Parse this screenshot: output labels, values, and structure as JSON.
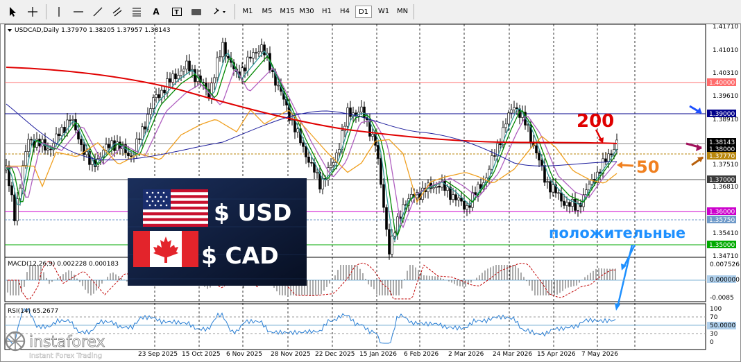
{
  "toolbar": {
    "timeframes": [
      "M1",
      "M5",
      "M15",
      "M30",
      "H1",
      "H4",
      "D1",
      "W1",
      "MN"
    ],
    "active_timeframe": "D1"
  },
  "chart": {
    "header": "USDCAD,Daily  1.37970 1.38205 1.37957 1.38143",
    "price_labels": [
      "1.41710",
      "1.41010",
      "1.40310",
      "1.39610",
      "1.38910",
      "1.37510",
      "1.36810",
      "1.35410",
      "1.34710"
    ],
    "level_labels": [
      {
        "text": "1.40000",
        "bg": "#ff6b6b"
      },
      {
        "text": "1.39000",
        "bg": "#00008b"
      },
      {
        "text": "1.38143",
        "bg": "#000000"
      },
      {
        "text": "1.38000",
        "bg": "#000000"
      },
      {
        "text": "1.37770",
        "bg": "#b8860b"
      },
      {
        "text": "1.37000",
        "bg": "#3a3a3a"
      },
      {
        "text": "1.36000",
        "bg": "#cc00cc"
      },
      {
        "text": "1.35750",
        "bg": "#6f9ac9"
      },
      {
        "text": "1.35000",
        "bg": "#00aa00"
      }
    ],
    "date_labels": [
      "23 Sep 2025",
      "15 Oct 2025",
      "6 Nov 2025",
      "28 Nov 2025",
      "22 Dec 2025",
      "15 Jan 2026",
      "6 Feb 2026",
      "2 Mar 2026",
      "24 Mar 2026",
      "15 Apr 2026",
      "7 May 2026"
    ],
    "annotations": {
      "ma200": "200",
      "ma50": "50",
      "positive": "положительные"
    }
  },
  "macd": {
    "header": "MACD(12,26,9) 0.002228 0.000183",
    "labels": [
      "0.007526",
      "0.000000",
      "-0.0085"
    ]
  },
  "rsi": {
    "header": "RSI(14) 65.2677",
    "labels": [
      "100",
      "70",
      "50.0000",
      "30",
      "0"
    ]
  },
  "banner": {
    "usd": "$ USD",
    "cad": "$ CAD"
  },
  "logo": {
    "name": "instaforex",
    "tagline": "Instant Forex Trading"
  },
  "colors": {
    "ma200": "#e00000",
    "ma50": "#f0a020",
    "ma_blue": "#1c1c9c",
    "ma_green": "#008800",
    "ma_teal": "#339999",
    "ma_violet": "#b060c0",
    "annotation_blue": "#1e90ff",
    "annotation_red": "#e00000",
    "annotation_orange": "#f08020"
  }
}
